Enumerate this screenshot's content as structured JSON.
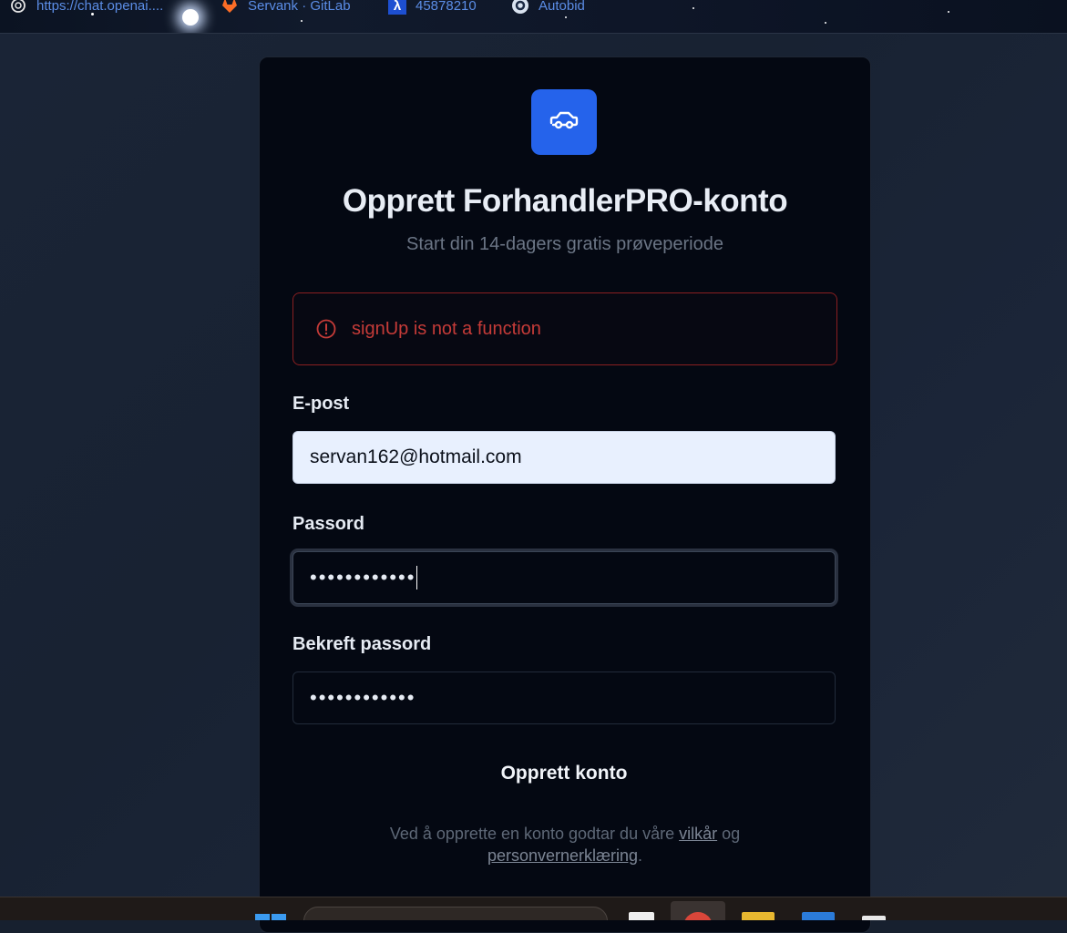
{
  "bookmarks": [
    {
      "label": "https://chat.openai....",
      "icon": "chatgpt-icon"
    },
    {
      "label": "Servank · GitLab",
      "icon": "gitlab-icon"
    },
    {
      "label": "45878210",
      "icon": "lambda-icon"
    },
    {
      "label": "Autobid",
      "icon": "autobid-icon"
    }
  ],
  "form": {
    "title": "Opprett ForhandlerPRO-konto",
    "subtitle": "Start din 14-dagers gratis prøveperiode",
    "error": "signUp is not a function",
    "email_label": "E-post",
    "email_value": "servan162@hotmail.com",
    "password_label": "Passord",
    "password_value": "••••••••••••",
    "confirm_label": "Bekreft passord",
    "confirm_value": "••••••••••••",
    "submit_label": "Opprett konto",
    "terms_prefix": "Ved å opprette en konto godtar du våre ",
    "terms_link": "vilkår",
    "terms_middle": " og",
    "privacy_link": "personvernerklæring",
    "terms_suffix": "."
  },
  "colors": {
    "accent": "#2563eb",
    "error": "#c53b38",
    "card_bg": "#040812",
    "page_bg": "#17202f"
  }
}
